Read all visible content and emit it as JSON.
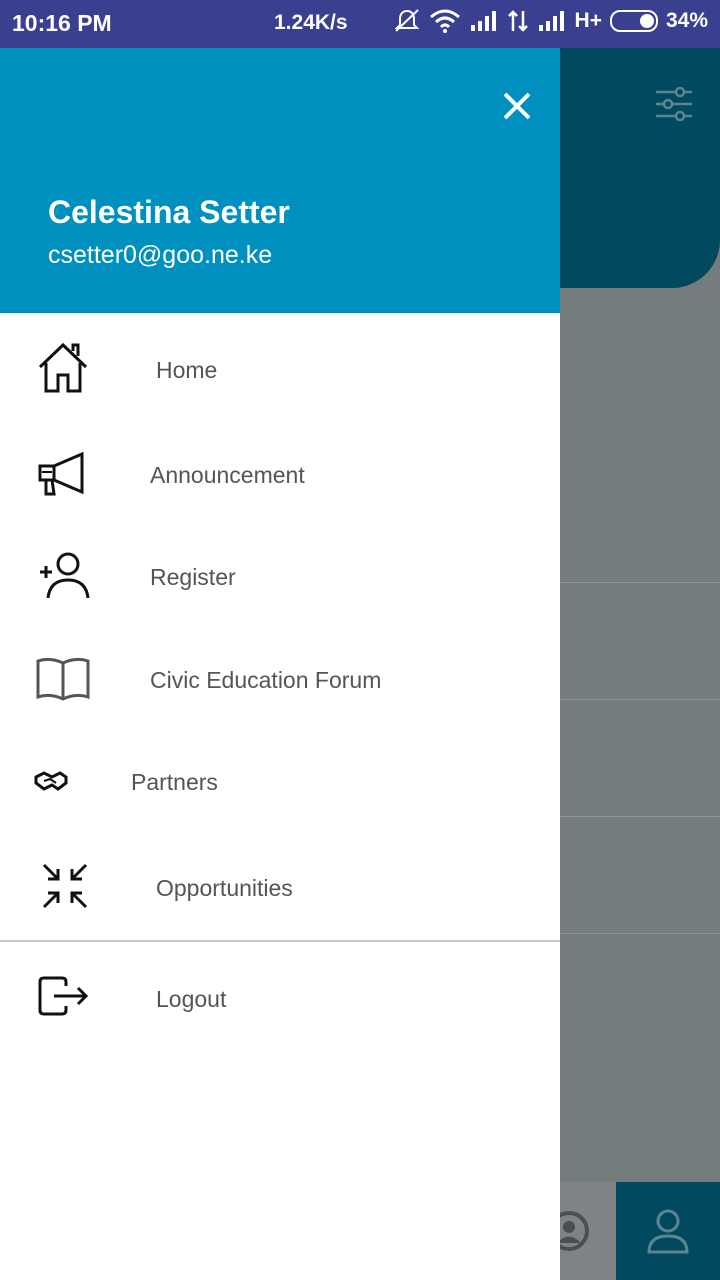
{
  "status_bar": {
    "time": "10:16 PM",
    "net_speed": "1.24K/s",
    "network_type": "H+",
    "battery": "34%",
    "icons": [
      "mute-icon",
      "wifi-icon",
      "signal-icon",
      "data-arrows-icon",
      "signal-icon",
      "battery-icon"
    ]
  },
  "drawer": {
    "user": {
      "name": "Celestina Setter",
      "email": "csetter0@goo.ne.ke"
    },
    "menu": [
      {
        "label": "Home",
        "icon": "home-icon"
      },
      {
        "label": "Announcement",
        "icon": "megaphone-icon"
      },
      {
        "label": "Register",
        "icon": "add-user-icon"
      },
      {
        "label": "Civic Education Forum",
        "icon": "book-icon"
      },
      {
        "label": "Partners",
        "icon": "handshake-icon"
      },
      {
        "label": "Opportunities",
        "icon": "compress-arrows-icon"
      }
    ],
    "logout": {
      "label": "Logout",
      "icon": "logout-icon"
    }
  },
  "colors": {
    "status_bar": "#3a3f8f",
    "drawer_header": "#0090bf",
    "app_header": "#00495f",
    "scrim": "#757c7e"
  }
}
